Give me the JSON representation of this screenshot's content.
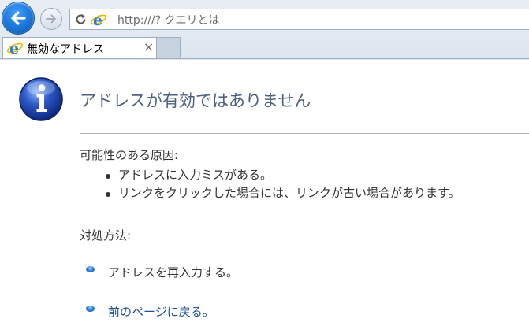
{
  "browser": {
    "address": "http:///? クエリとは",
    "tab": {
      "title": "無効なアドレス",
      "close_glyph": "×"
    }
  },
  "error_page": {
    "title": "アドレスが有効ではありません",
    "causes_heading": "可能性のある原因:",
    "causes": [
      "アドレスに入力ミスがある。",
      "リンクをクリックした場合には、リンクが古い場合があります。"
    ],
    "actions_heading": "対処方法:",
    "actions": [
      {
        "text": "アドレスを再入力する。",
        "is_link": false
      },
      {
        "text": "前のページに戻る。",
        "is_link": true
      }
    ]
  },
  "icons": {
    "back": "arrow-left-icon",
    "forward": "arrow-right-icon",
    "refresh": "refresh-icon",
    "browser": "internet-explorer-icon",
    "info": "info-icon"
  },
  "colors": {
    "title": "#4d6082",
    "link": "#1f4f9c",
    "back_button": "#1b74d6",
    "chrome": "#dde5ef"
  }
}
